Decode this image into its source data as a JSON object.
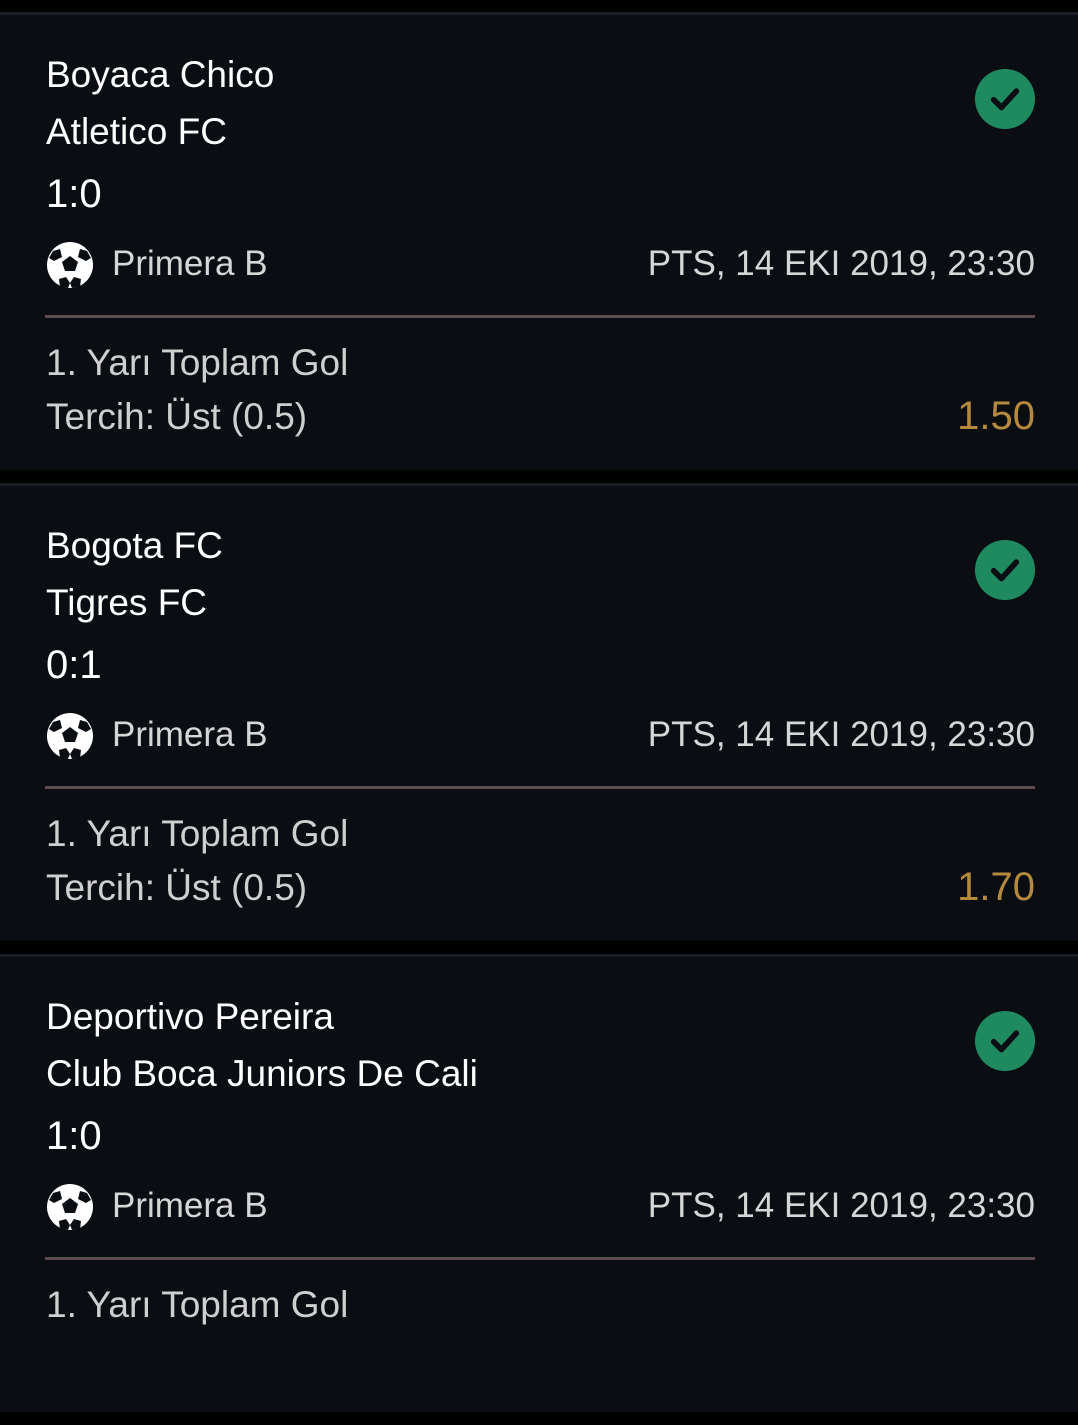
{
  "accent_colors": {
    "check_green": "#1f8a5f",
    "odds_gold": "#b58a3e",
    "divider": "#5b4d4f",
    "card_bg": "#0a0d12"
  },
  "bets": [
    {
      "home_team": "Boyaca Chico",
      "away_team": "Atletico FC",
      "score": "1:0",
      "status_icon": "check-circle-icon",
      "sport_icon": "soccer-ball-icon",
      "league": "Primera B",
      "datetime": "PTS, 14 EKI 2019, 23:30",
      "market": "1. Yarı Toplam Gol",
      "pick": "Tercih: Üst (0.5)",
      "odds": "1.50"
    },
    {
      "home_team": "Bogota FC",
      "away_team": "Tigres FC",
      "score": "0:1",
      "status_icon": "check-circle-icon",
      "sport_icon": "soccer-ball-icon",
      "league": "Primera B",
      "datetime": "PTS, 14 EKI 2019, 23:30",
      "market": "1. Yarı Toplam Gol",
      "pick": "Tercih: Üst (0.5)",
      "odds": "1.70"
    },
    {
      "home_team": "Deportivo Pereira",
      "away_team": "Club Boca Juniors De Cali",
      "score": "1:0",
      "status_icon": "check-circle-icon",
      "sport_icon": "soccer-ball-icon",
      "league": "Primera B",
      "datetime": "PTS, 14 EKI 2019, 23:30",
      "market": "1. Yarı Toplam Gol"
    }
  ]
}
